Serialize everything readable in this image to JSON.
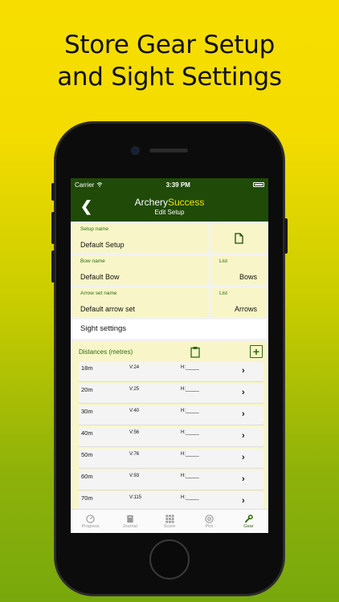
{
  "headline": {
    "line1": "Store Gear Setup",
    "line2": "and Sight Settings"
  },
  "status": {
    "carrier": "Carrier",
    "time": "3:39 PM"
  },
  "nav": {
    "app_name_part1": "Archery",
    "app_name_part2": "Success",
    "subtitle": "Edit Setup",
    "back_icon": "chevron-left-icon"
  },
  "setup": {
    "setup_name_label": "Setup name",
    "setup_name_value": "Default Setup",
    "bow_name_label": "Bow name",
    "bow_name_value": "Default Bow",
    "bow_list_label": "List",
    "bow_list_value": "Bows",
    "arrow_set_label": "Arrow set name",
    "arrow_set_value": "Default arrow set",
    "arrow_list_label": "List",
    "arrow_list_value": "Arrows"
  },
  "sight": {
    "section_title": "Sight settings",
    "distances_title": "Distances (metres)",
    "rows": [
      {
        "distance": "18m",
        "v": "V:24",
        "h": "H:_____"
      },
      {
        "distance": "20m",
        "v": "V:25",
        "h": "H:_____"
      },
      {
        "distance": "30m",
        "v": "V:40",
        "h": "H:_____"
      },
      {
        "distance": "40m",
        "v": "V:56",
        "h": "H:_____"
      },
      {
        "distance": "50m",
        "v": "V:76",
        "h": "H:_____"
      },
      {
        "distance": "60m",
        "v": "V:93",
        "h": "H:_____"
      },
      {
        "distance": "70m",
        "v": "V:115",
        "h": "H:_____"
      }
    ]
  },
  "tabs": [
    {
      "label": "Progress",
      "icon": "speedometer-icon"
    },
    {
      "label": "Journal",
      "icon": "book-icon"
    },
    {
      "label": "Score",
      "icon": "grid-icon"
    },
    {
      "label": "Plot",
      "icon": "target-icon"
    },
    {
      "label": "Gear",
      "icon": "wrench-icon",
      "active": true
    }
  ],
  "colors": {
    "nav_green": "#1f4a07",
    "accent_green": "#2e6b10",
    "field_bg": "#f8f6c8",
    "title_yellow": "#f2e300"
  }
}
